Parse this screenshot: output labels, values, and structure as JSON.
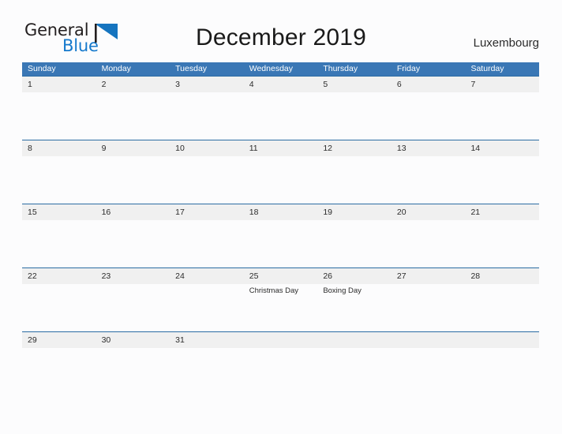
{
  "brand": {
    "name_part1": "General",
    "name_part2": "Blue",
    "flag_icon": "blue-triangle-flag",
    "color_dark": "#231f20",
    "color_blue": "#1579cc"
  },
  "header": {
    "title": "December 2019",
    "country": "Luxembourg"
  },
  "colors": {
    "header_bar": "#3a77b5",
    "row_band": "#f0f0f0",
    "row_rule": "#2b6ca3",
    "page_background": "#fcfcfd",
    "text": "#2b2b2b"
  },
  "calendar": {
    "month": "December",
    "year": "2019",
    "weekday_headers": [
      "Sunday",
      "Monday",
      "Tuesday",
      "Wednesday",
      "Thursday",
      "Friday",
      "Saturday"
    ],
    "weeks": [
      {
        "days": [
          {
            "num": "1",
            "events": []
          },
          {
            "num": "2",
            "events": []
          },
          {
            "num": "3",
            "events": []
          },
          {
            "num": "4",
            "events": []
          },
          {
            "num": "5",
            "events": []
          },
          {
            "num": "6",
            "events": []
          },
          {
            "num": "7",
            "events": []
          }
        ]
      },
      {
        "days": [
          {
            "num": "8",
            "events": []
          },
          {
            "num": "9",
            "events": []
          },
          {
            "num": "10",
            "events": []
          },
          {
            "num": "11",
            "events": []
          },
          {
            "num": "12",
            "events": []
          },
          {
            "num": "13",
            "events": []
          },
          {
            "num": "14",
            "events": []
          }
        ]
      },
      {
        "days": [
          {
            "num": "15",
            "events": []
          },
          {
            "num": "16",
            "events": []
          },
          {
            "num": "17",
            "events": []
          },
          {
            "num": "18",
            "events": []
          },
          {
            "num": "19",
            "events": []
          },
          {
            "num": "20",
            "events": []
          },
          {
            "num": "21",
            "events": []
          }
        ]
      },
      {
        "days": [
          {
            "num": "22",
            "events": []
          },
          {
            "num": "23",
            "events": []
          },
          {
            "num": "24",
            "events": []
          },
          {
            "num": "25",
            "events": [
              "Christmas Day"
            ]
          },
          {
            "num": "26",
            "events": [
              "Boxing Day"
            ]
          },
          {
            "num": "27",
            "events": []
          },
          {
            "num": "28",
            "events": []
          }
        ]
      },
      {
        "days": [
          {
            "num": "29",
            "events": []
          },
          {
            "num": "30",
            "events": []
          },
          {
            "num": "31",
            "events": []
          },
          {
            "num": "",
            "events": []
          },
          {
            "num": "",
            "events": []
          },
          {
            "num": "",
            "events": []
          },
          {
            "num": "",
            "events": []
          }
        ]
      }
    ]
  }
}
